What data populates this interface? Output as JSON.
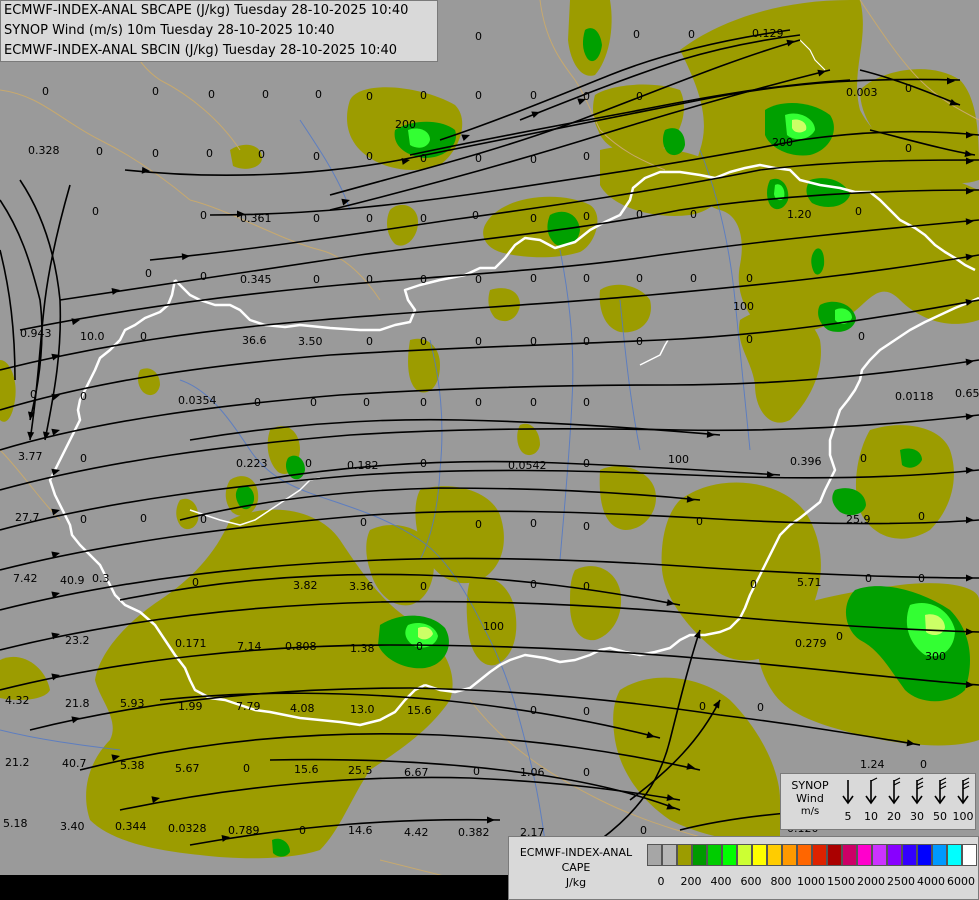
{
  "titles": {
    "line1": "ECMWF-INDEX-ANAL SBCAPE (J/kg) Tuesday 28-10-2025 10:40",
    "line2": "SYNOP Wind (m/s) 10m Tuesday 28-10-2025 10:40",
    "line3": "ECMWF-INDEX-ANAL SBCIN (J/kg) Tuesday 28-10-2025 10:40"
  },
  "synop_legend": {
    "title_line1": "SYNOP",
    "title_line2": "Wind",
    "title_line3": "m/s",
    "speeds": [
      "5",
      "10",
      "20",
      "30",
      "50",
      "100"
    ]
  },
  "cape_legend": {
    "title_line1": "ECMWF-INDEX-ANAL",
    "title_line2": "CAPE",
    "title_line3": "J/kg",
    "tick_labels": [
      "0",
      "200",
      "400",
      "600",
      "800",
      "1000",
      "1500",
      "2000",
      "2500",
      "4000",
      "6000"
    ],
    "colors": [
      "#a6a6a6",
      "#b6b6b6",
      "#9c9c00",
      "#009a00",
      "#00cc00",
      "#00ff00",
      "#ccff33",
      "#ffff00",
      "#ffcc00",
      "#ff9900",
      "#ff6600",
      "#dd2200",
      "#aa0000",
      "#cc0066",
      "#ff00cc",
      "#cc33ff",
      "#8800ff",
      "#3300ff",
      "#0000ff",
      "#0099ff",
      "#00ffff",
      "#ffffff"
    ]
  },
  "map_colors": {
    "background": "#9a9a9a",
    "cape_low": "#9c9c00",
    "cape_mid": "#009a00",
    "cape_high": "#00ff00",
    "border": "#ffffff",
    "streamline": "#000000"
  },
  "value_labels": [
    "0",
    "0",
    "0",
    "0",
    "0",
    "0.129",
    "0",
    "0",
    "0",
    "0",
    "0",
    "0",
    "0",
    "0",
    "0",
    "0.003",
    "0",
    "0.328",
    "0",
    "0",
    "0",
    "0",
    "200",
    "0",
    "0",
    "0",
    "0",
    "0",
    "0",
    "200",
    "0",
    "0",
    "0",
    "0.361",
    "0",
    "0",
    "0",
    "0",
    "0",
    "0",
    "0",
    "0",
    "1.20",
    "0",
    "0",
    "0",
    "0.345",
    "0",
    "0",
    "0",
    "0",
    "0",
    "0",
    "0",
    "0",
    "0",
    "0.943",
    "10.0",
    "0",
    "36.6",
    "3.50",
    "0",
    "0",
    "0",
    "0",
    "0",
    "0",
    "100",
    "0",
    "0",
    "0",
    "0",
    "0.0354",
    "0",
    "0",
    "0",
    "0",
    "0",
    "0",
    "0",
    "0.0118",
    "0.65",
    "3.77",
    "0",
    "0.223",
    "0",
    "0.182",
    "0",
    "0.0542",
    "0",
    "100",
    "0.396",
    "0",
    "27.7",
    "0",
    "0",
    "0",
    "0",
    "0",
    "0",
    "0",
    "0",
    "25.9",
    "0",
    "7.42",
    "40.9",
    "0.3",
    "0",
    "3.82",
    "3.36",
    "0",
    "0",
    "0",
    "0",
    "5.71",
    "0",
    "0",
    "23.2",
    "0.171",
    "7.14",
    "0.808",
    "1.38",
    "0",
    "100",
    "0.279",
    "0",
    "300",
    "4.32",
    "21.8",
    "5.93",
    "1.99",
    "7.79",
    "4.08",
    "13.0",
    "15.6",
    "0",
    "0",
    "0",
    "0",
    "21.2",
    "40.7",
    "5.38",
    "5.67",
    "0",
    "15.6",
    "25.5",
    "6.67",
    "0",
    "1.06",
    "0",
    "1.24",
    "0",
    "5.18",
    "3.40",
    "0.344",
    "0.0328",
    "0.789",
    "0",
    "14.6",
    "4.42",
    "0.382",
    "2.17",
    "0",
    "0.120"
  ]
}
